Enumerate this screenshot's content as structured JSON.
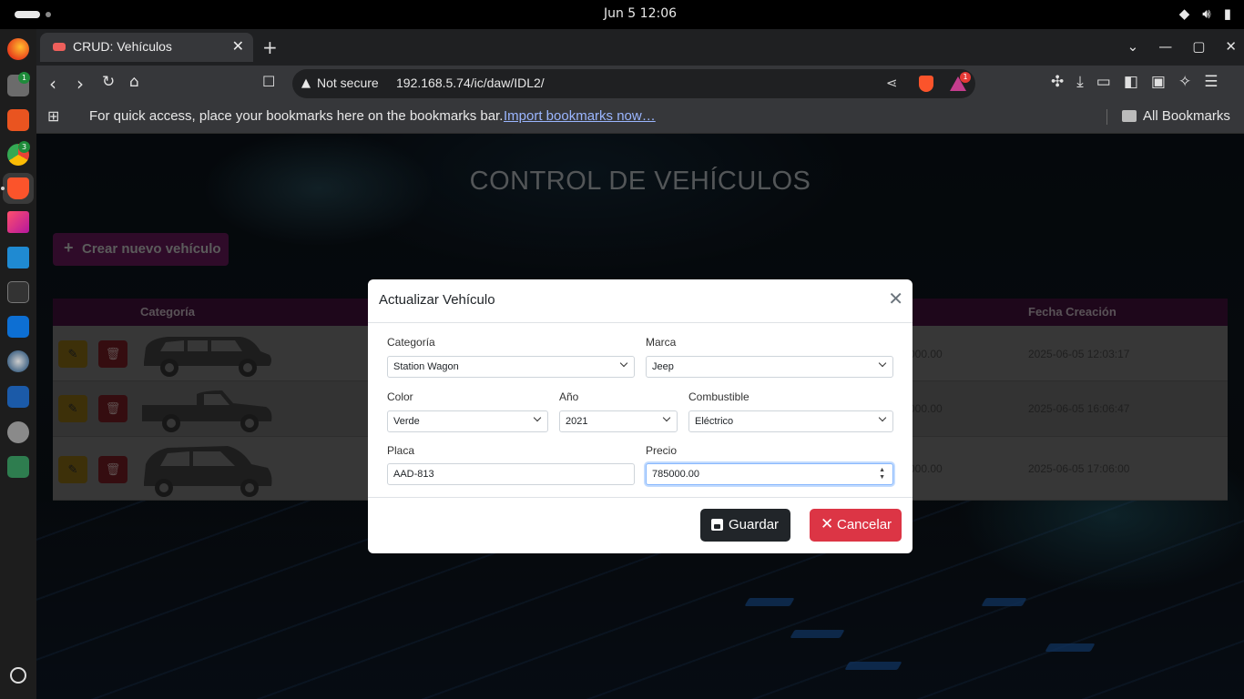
{
  "system": {
    "clock": "Jun 5  12:06"
  },
  "dock": {
    "badges": [
      "1",
      "3"
    ]
  },
  "browser": {
    "tab_title": "CRUD: Vehículos",
    "security": "Not secure",
    "url": "192.168.5.74/ic/daw/IDL2/",
    "rewards_badge": "1",
    "bookmarks_message": "For quick access, place your bookmarks here on the bookmarks bar.",
    "bookmarks_import": "Import bookmarks now…",
    "all_bookmarks": "All Bookmarks"
  },
  "page": {
    "heading": "CONTROL DE VEHÍCULOS",
    "create_button": "Crear nuevo vehículo",
    "table": {
      "columns": {
        "category": "Categoría",
        "created": "Fecha Creación"
      },
      "rows": [
        {
          "price": "000.00",
          "created": "2025-06-05 12:03:17",
          "car": "station-wagon"
        },
        {
          "price": "000.00",
          "created": "2025-06-05 16:06:47",
          "car": "pickup"
        },
        {
          "price": "000.00",
          "created": "2025-06-05 17:06:00",
          "car": "suv"
        }
      ]
    }
  },
  "modal": {
    "title": "Actualizar Vehículo",
    "fields": {
      "categoria": {
        "label": "Categoría",
        "value": "Station Wagon"
      },
      "marca": {
        "label": "Marca",
        "value": "Jeep"
      },
      "color": {
        "label": "Color",
        "value": "Verde"
      },
      "anio": {
        "label": "Año",
        "value": "2021"
      },
      "combustible": {
        "label": "Combustible",
        "value": "Eléctrico"
      },
      "placa": {
        "label": "Placa",
        "value": "AAD-813"
      },
      "precio": {
        "label": "Precio",
        "value": "785000.00"
      }
    },
    "save_label": "Guardar",
    "cancel_label": "Cancelar"
  },
  "colors": {
    "accent_purple": "#5e1753",
    "save_button": "#212529",
    "cancel_button": "#dc3545",
    "edit_button": "#ffc107",
    "delete_button": "#dc3545"
  }
}
